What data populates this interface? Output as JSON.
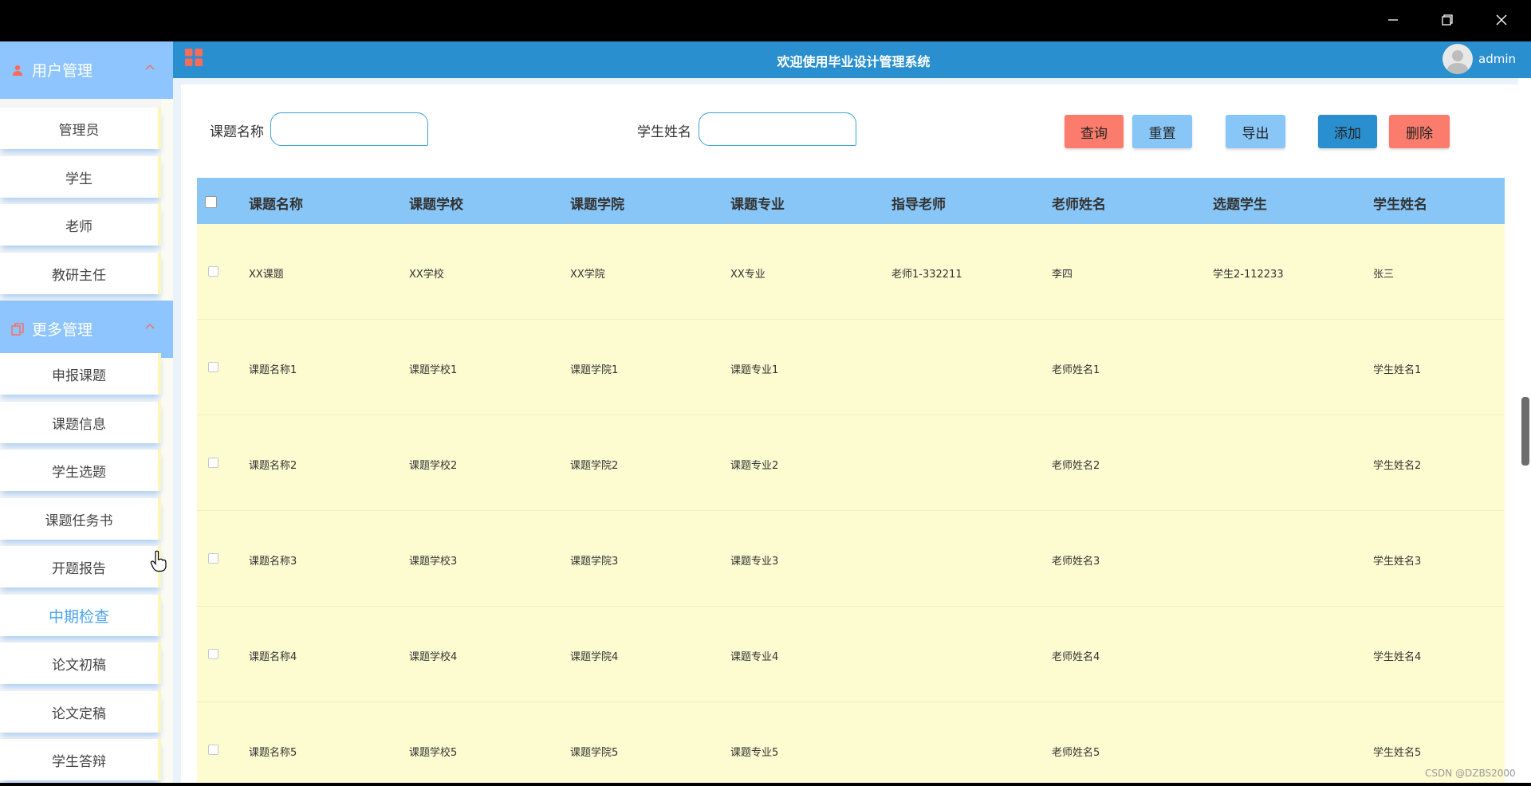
{
  "header": {
    "title": "欢迎使用毕业设计管理系统",
    "username": "admin"
  },
  "sidebar": {
    "groups": [
      {
        "label": "用户管理",
        "icon": "user-icon",
        "items": [
          {
            "label": "管理员"
          },
          {
            "label": "学生"
          },
          {
            "label": "老师"
          },
          {
            "label": "教研主任"
          }
        ]
      },
      {
        "label": "更多管理",
        "icon": "copy-icon",
        "items": [
          {
            "label": "申报课题"
          },
          {
            "label": "课题信息"
          },
          {
            "label": "学生选题"
          },
          {
            "label": "课题任务书"
          },
          {
            "label": "开题报告"
          },
          {
            "label": "中期检查",
            "active": true
          },
          {
            "label": "论文初稿"
          },
          {
            "label": "论文定稿"
          },
          {
            "label": "学生答辩"
          }
        ]
      }
    ]
  },
  "search": {
    "topic_label": "课题名称",
    "topic_value": "",
    "student_label": "学生姓名",
    "student_value": ""
  },
  "toolbar": {
    "query": "查询",
    "reset": "重置",
    "export": "导出",
    "add": "添加",
    "delete": "删除"
  },
  "table": {
    "columns": [
      "课题名称",
      "课题学校",
      "课题学院",
      "课题专业",
      "指导老师",
      "老师姓名",
      "选题学生",
      "学生姓名"
    ],
    "rows": [
      [
        "XX课题",
        "XX学校",
        "XX学院",
        "XX专业",
        "老师1-332211",
        "李四",
        "学生2-112233",
        "张三"
      ],
      [
        "课题名称1",
        "课题学校1",
        "课题学院1",
        "课题专业1",
        "",
        "老师姓名1",
        "",
        "学生姓名1"
      ],
      [
        "课题名称2",
        "课题学校2",
        "课题学院2",
        "课题专业2",
        "",
        "老师姓名2",
        "",
        "学生姓名2"
      ],
      [
        "课题名称3",
        "课题学校3",
        "课题学院3",
        "课题专业3",
        "",
        "老师姓名3",
        "",
        "学生姓名3"
      ],
      [
        "课题名称4",
        "课题学校4",
        "课题学院4",
        "课题专业4",
        "",
        "老师姓名4",
        "",
        "学生姓名4"
      ],
      [
        "课题名称5",
        "课题学校5",
        "课题学院5",
        "课题专业5",
        "",
        "老师姓名5",
        "",
        "学生姓名5"
      ]
    ]
  },
  "watermark": "CSDN @DZBS2000",
  "colors": {
    "header_bg": "#2a8fcf",
    "group_bg": "#8ec5ff",
    "table_head_bg": "#88c6f7",
    "row_bg": "#fdfbd0",
    "danger": "#fb7c6c",
    "active_item": "#4aa3ef"
  }
}
